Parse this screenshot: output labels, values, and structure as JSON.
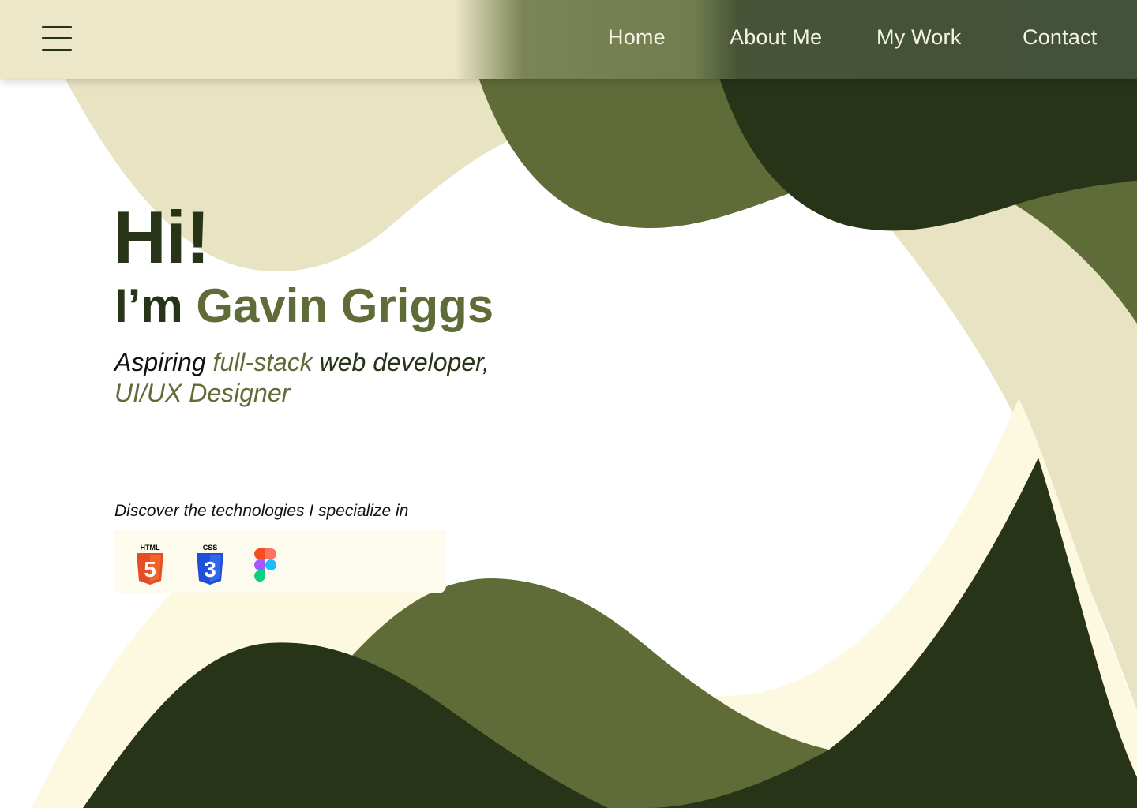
{
  "header": {
    "menu_icon": "hamburger-menu-icon",
    "nav": [
      {
        "label": "Home"
      },
      {
        "label": "About Me"
      },
      {
        "label": "My Work"
      },
      {
        "label": "Contact"
      }
    ]
  },
  "hero": {
    "greeting": "Hi!",
    "intro_prefix": "I’m ",
    "name": "Gavin Griggs",
    "tagline": {
      "part1": "Aspiring ",
      "part2": "full-stack",
      "part3": " web developer,",
      "line2": "UI/UX Designer"
    }
  },
  "technologies": {
    "heading": "Discover the technologies I specialize in",
    "items": [
      {
        "name": "html5-icon",
        "label": "HTML",
        "glyph": "5",
        "color": "#e44d26"
      },
      {
        "name": "css3-icon",
        "label": "CSS",
        "glyph": "3",
        "color": "#1572b6"
      },
      {
        "name": "figma-icon",
        "colors": [
          "#f24e1e",
          "#ff7262",
          "#a259ff",
          "#1abcfe",
          "#0acf83"
        ]
      }
    ]
  },
  "colors": {
    "dark_green": "#283418",
    "olive": "#5f6c37",
    "cream": "#ece7c9",
    "light_cream": "#fdfbee",
    "nav_text": "#f7f3e2"
  }
}
